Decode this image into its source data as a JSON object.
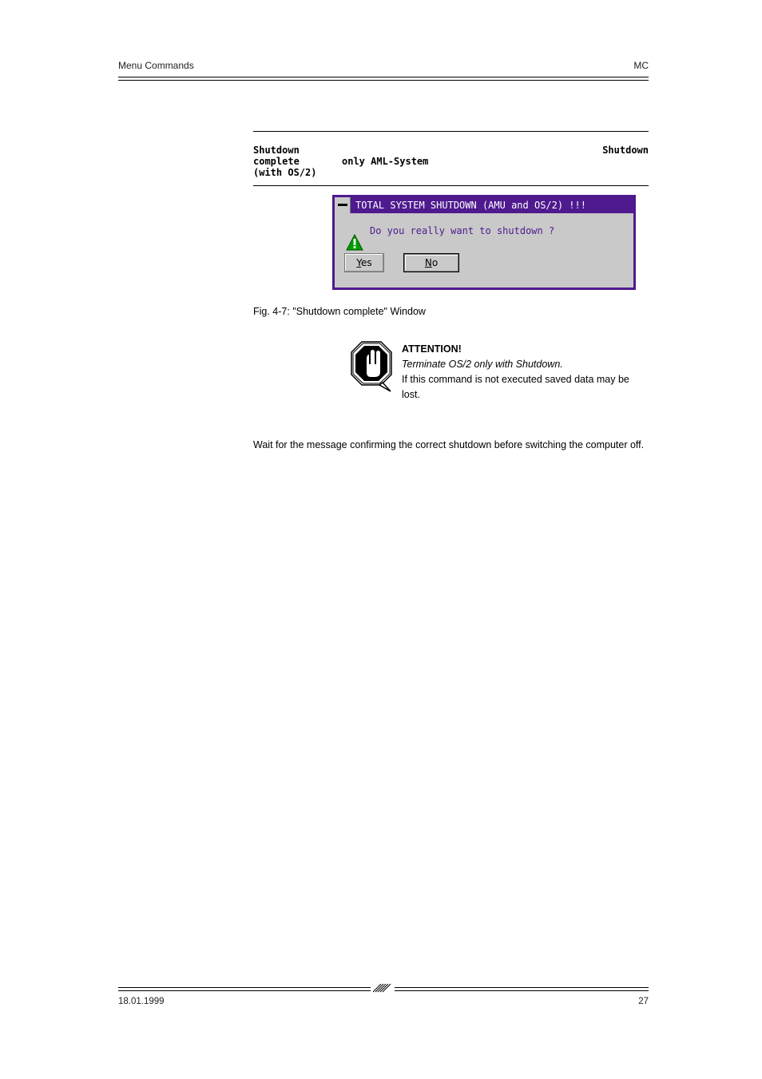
{
  "header": {
    "left": "Menu Commands",
    "right": "MC"
  },
  "table_row": {
    "col1_label": "Shutdown\ncomplete\n(with OS/2)",
    "col2_label": "only AML-System",
    "col3_label": "Shutdown"
  },
  "dialog": {
    "title": "TOTAL SYSTEM SHUTDOWN (AMU and OS/2) !!!",
    "message": "Do you really want to shutdown ?",
    "yes_char": "Y",
    "yes_rest": "es",
    "no_char": "N",
    "no_rest": "o",
    "icon_name": "warning-triangle-icon",
    "sysmenu_name": "system-menu-icon"
  },
  "figure_caption": "Fig. 4-7: \"Shutdown complete\" Window",
  "attention": {
    "heading": "ATTENTION!",
    "line_html": "Terminate OS/2 only with <i>Shutdown</i>.",
    "tail": "If this command is not executed saved data may be lost.",
    "after_block": "Wait for the message confirming the correct shutdown before switching the computer off."
  },
  "stop_icon": {
    "name": "stop-hand-icon"
  },
  "footer": {
    "left": "18.01.1999",
    "right": "27"
  },
  "colors": {
    "purple": "#4e1a8e",
    "dialog_bg": "#c9c9c9"
  }
}
